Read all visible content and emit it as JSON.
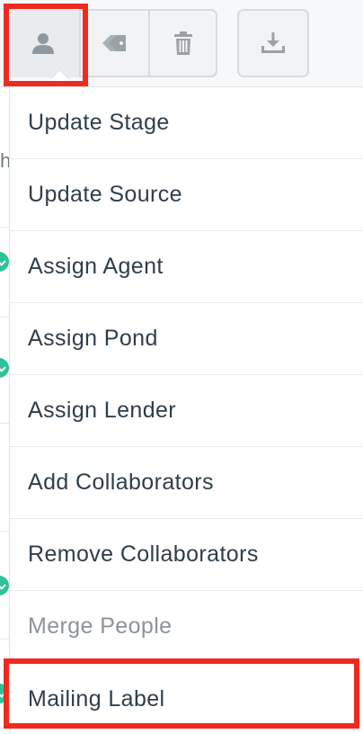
{
  "toolbar": {
    "buttons": [
      {
        "name": "person-icon",
        "action": "assign"
      },
      {
        "name": "tag-icon",
        "action": "tag"
      },
      {
        "name": "trash-icon",
        "action": "delete"
      },
      {
        "name": "download-icon",
        "action": "export"
      }
    ]
  },
  "background": {
    "partial_text": "h"
  },
  "menu": {
    "items": [
      {
        "label": "Update Stage",
        "enabled": true
      },
      {
        "label": "Update Source",
        "enabled": true
      },
      {
        "label": "Assign Agent",
        "enabled": true
      },
      {
        "label": "Assign Pond",
        "enabled": true
      },
      {
        "label": "Assign Lender",
        "enabled": true
      },
      {
        "label": "Add Collaborators",
        "enabled": true
      },
      {
        "label": "Remove Collaborators",
        "enabled": true
      },
      {
        "label": "Merge People",
        "enabled": false
      },
      {
        "label": "Mailing Label",
        "enabled": true
      }
    ]
  },
  "colors": {
    "highlight": "#ef2b1f",
    "text": "#2f3e4a",
    "disabled_text": "#8b949a",
    "status_dot": "#2fc198"
  }
}
